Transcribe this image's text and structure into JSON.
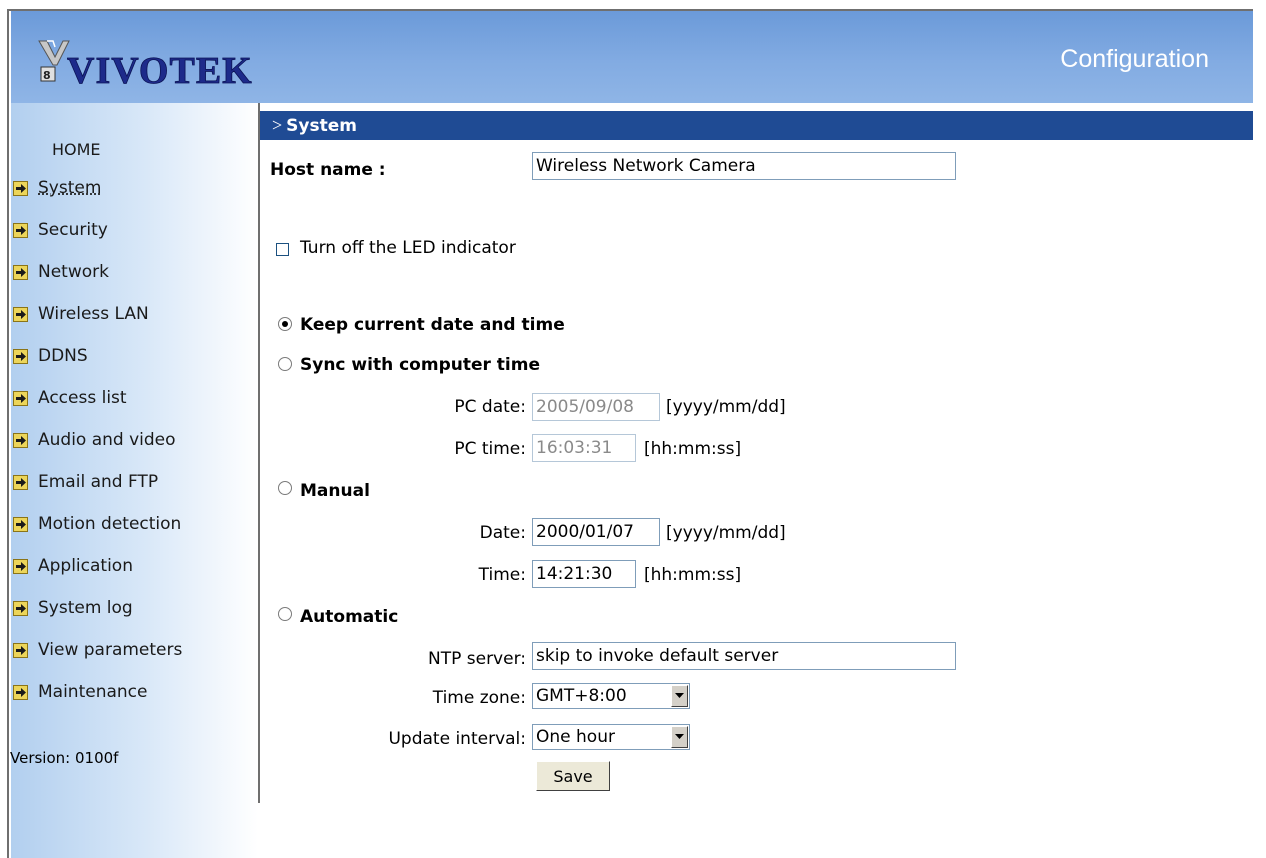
{
  "header": {
    "logo_text": "VIVOTEK",
    "title": "Configuration"
  },
  "sidebar": {
    "home": "HOME",
    "items": [
      {
        "label": "System",
        "active": true
      },
      {
        "label": "Security"
      },
      {
        "label": "Network"
      },
      {
        "label": "Wireless LAN"
      },
      {
        "label": "DDNS"
      },
      {
        "label": "Access list"
      },
      {
        "label": "Audio and video"
      },
      {
        "label": "Email and FTP"
      },
      {
        "label": "Motion detection"
      },
      {
        "label": "Application"
      },
      {
        "label": "System log"
      },
      {
        "label": "View parameters"
      },
      {
        "label": "Maintenance"
      }
    ],
    "version": "Version: 0100f"
  },
  "section": {
    "prefix": ">",
    "title": "System"
  },
  "form": {
    "host_name_label": "Host name :",
    "host_name_value": "Wireless Network Camera",
    "led_label": "Turn off the LED indicator",
    "led_checked": false,
    "keep_label": "Keep current date and time",
    "sync_label": "Sync with computer time",
    "pc_date_label": "PC date:",
    "pc_date_value": "2005/09/08",
    "pc_date_hint": "[yyyy/mm/dd]",
    "pc_time_label": "PC time:",
    "pc_time_value": "16:03:31",
    "pc_time_hint": "[hh:mm:ss]",
    "manual_label": "Manual",
    "date_label": "Date:",
    "date_value": "2000/01/07",
    "date_hint": "[yyyy/mm/dd]",
    "time_label": "Time:",
    "time_value": "14:21:30",
    "time_hint": "[hh:mm:ss]",
    "automatic_label": "Automatic",
    "ntp_label": "NTP server:",
    "ntp_value": "skip to invoke default server",
    "tz_label": "Time zone:",
    "tz_value": "GMT+8:00",
    "interval_label": "Update interval:",
    "interval_value": "One hour",
    "save_label": "Save",
    "selected_mode": "keep"
  },
  "colors": {
    "header_bg": "#82abe2",
    "section_bar": "#1f4b94",
    "nav_arrow": "#ecd55a"
  }
}
